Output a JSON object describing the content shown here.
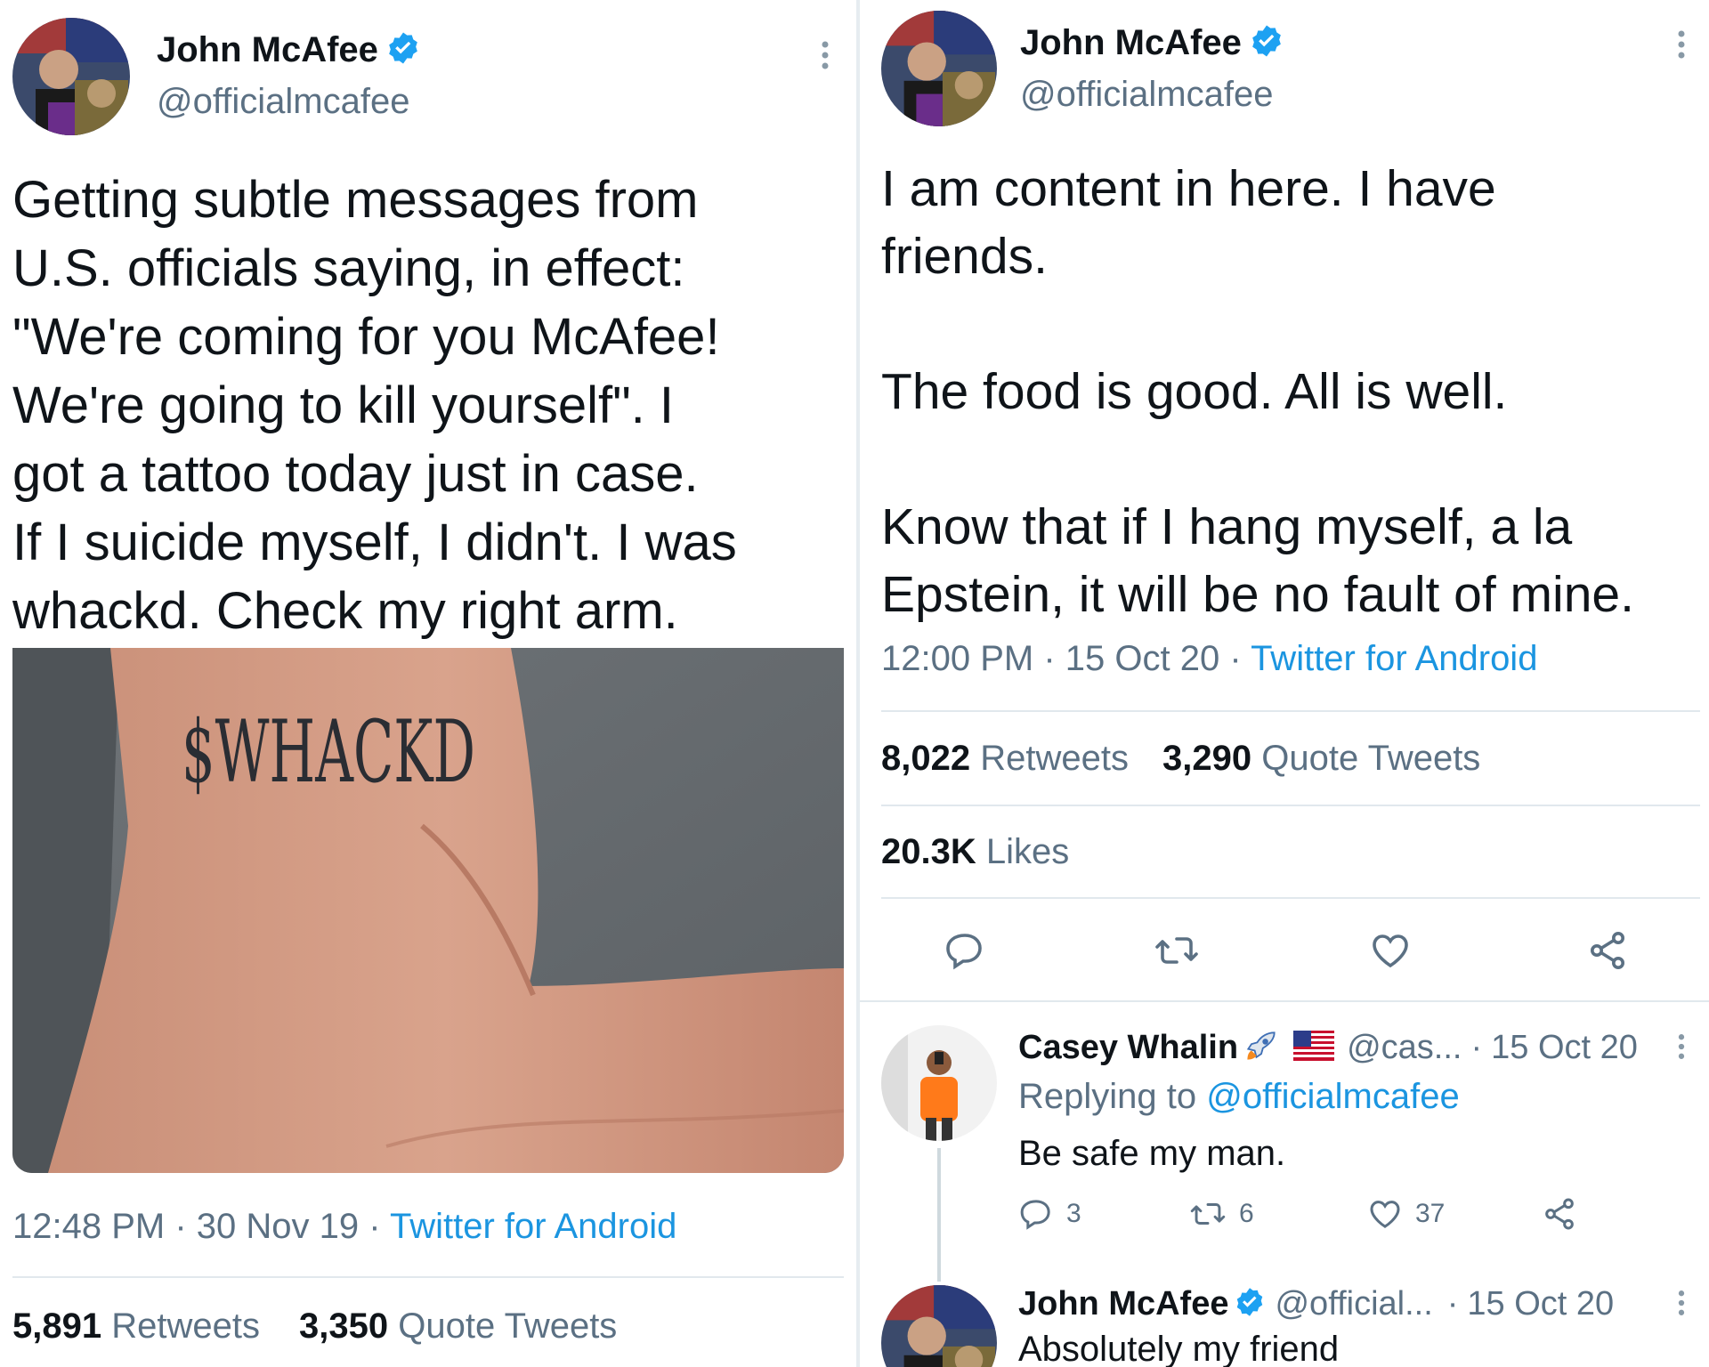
{
  "colors": {
    "link": "#1b95e0",
    "secondary_text": "#5b7083",
    "primary_text": "#0f1419",
    "verified": "#1da1f2"
  },
  "left_tweet": {
    "author": {
      "name": "John McAfee",
      "handle": "@officialmcafee",
      "verified": true
    },
    "text": "Getting subtle messages from\nU.S. officials saying, in effect:\n\"We're coming for you McAfee!\nWe're going to kill yourself\". I\ngot a tattoo today just in case.\nIf I suicide myself, I didn't. I was\nwhackd. Check my right arm.",
    "image": {
      "tattoo_text": "$WHACKD"
    },
    "time": "12:48 PM",
    "date": "30 Nov 19",
    "source": "Twitter for Android",
    "retweets": "5,891",
    "retweets_label": "Retweets",
    "quotes": "3,350",
    "quotes_label": "Quote Tweets"
  },
  "right_tweet": {
    "author": {
      "name": "John McAfee",
      "handle": "@officialmcafee",
      "verified": true
    },
    "text": "I am content in here. I have\nfriends.\n\nThe food is good. All is well.\n\nKnow that if I hang myself, a la\nEpstein, it will be no fault of mine.",
    "time": "12:00 PM",
    "date": "15 Oct 20",
    "source": "Twitter for Android",
    "retweets": "8,022",
    "retweets_label": "Retweets",
    "quotes": "3,290",
    "quotes_label": "Quote Tweets",
    "likes": "20.3K",
    "likes_label": "Likes",
    "actions": [
      "reply-icon",
      "retweet-icon",
      "like-icon",
      "share-icon"
    ]
  },
  "replies": [
    {
      "name": "Casey Whalin",
      "emoji_names": [
        "rocket-icon",
        "us-flag-icon"
      ],
      "handle": "@cas...",
      "date": "15 Oct 20",
      "replying_prefix": "Replying to",
      "replying_to": "@officialmcafee",
      "text": "Be safe my man.",
      "reply_count": "3",
      "retweet_count": "6",
      "like_count": "37"
    },
    {
      "name": "John McAfee",
      "verified": true,
      "handle": "@official...",
      "date": "15 Oct 20",
      "text": "Absolutely my friend"
    }
  ],
  "separators": {
    "dot": "·"
  }
}
